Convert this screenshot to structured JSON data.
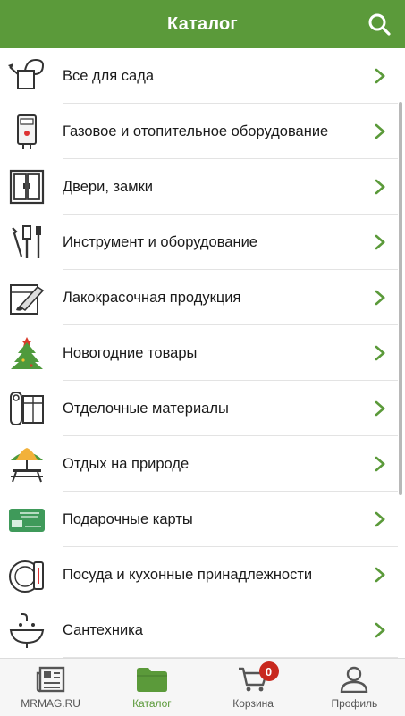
{
  "header": {
    "title": "Каталог"
  },
  "colors": {
    "brand": "#5b9a3a",
    "badge": "#c8281e",
    "chevron": "#5b9a3a"
  },
  "categories": [
    {
      "label": "Все для сада",
      "icon": "watering-can-icon"
    },
    {
      "label": "Газовое и отопительное оборудование",
      "icon": "boiler-icon"
    },
    {
      "label": "Двери, замки",
      "icon": "door-icon"
    },
    {
      "label": "Инструмент и оборудование",
      "icon": "tools-icon"
    },
    {
      "label": "Лакокрасочная продукция",
      "icon": "paint-brush-icon"
    },
    {
      "label": "Новогодние товары",
      "icon": "christmas-tree-icon"
    },
    {
      "label": "Отделочные материалы",
      "icon": "wallpaper-roll-icon"
    },
    {
      "label": "Отдых на природе",
      "icon": "picnic-table-icon"
    },
    {
      "label": "Подарочные карты",
      "icon": "gift-card-icon"
    },
    {
      "label": "Посуда и кухонные принадлежности",
      "icon": "kitchenware-icon"
    },
    {
      "label": "Сантехника",
      "icon": "sink-icon"
    }
  ],
  "tabbar": {
    "items": [
      {
        "label": "MRMAG.RU",
        "icon": "newspaper-icon"
      },
      {
        "label": "Каталог",
        "icon": "folder-icon"
      },
      {
        "label": "Корзина",
        "icon": "cart-icon",
        "badge": "0"
      },
      {
        "label": "Профиль",
        "icon": "person-icon"
      }
    ],
    "active": "Каталог"
  }
}
